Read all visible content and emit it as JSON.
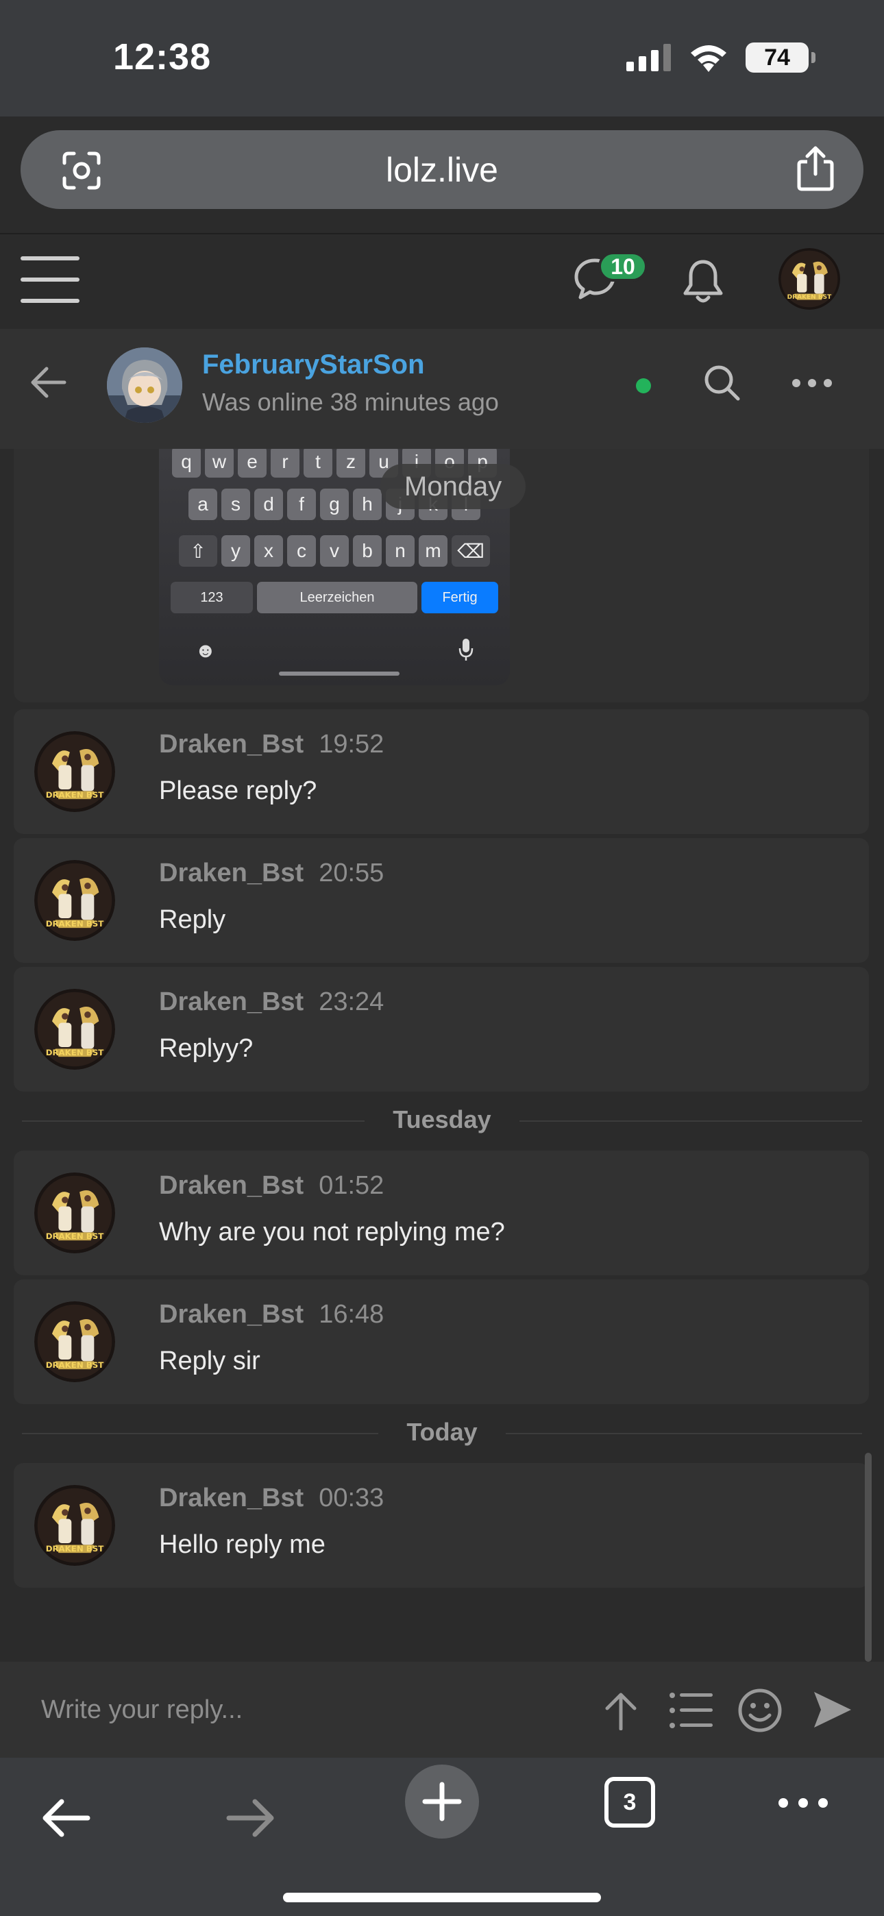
{
  "status_bar": {
    "time": "12:38",
    "battery": "74"
  },
  "browser": {
    "url": "lolz.live",
    "tab_count": "3"
  },
  "site_header": {
    "messages_badge": "10"
  },
  "conversation": {
    "name": "FebruaryStarSon",
    "status": "Was online 38 minutes ago"
  },
  "keyboard_image": {
    "row1": [
      "q",
      "w",
      "e",
      "r",
      "t",
      "z",
      "u",
      "i",
      "o",
      "p"
    ],
    "row2": [
      "a",
      "s",
      "d",
      "f",
      "g",
      "h",
      "j",
      "k",
      "l"
    ],
    "row3": [
      "y",
      "x",
      "c",
      "v",
      "b",
      "n",
      "m"
    ],
    "key_123": "123",
    "key_space": "Leerzeichen",
    "key_done": "Fertig"
  },
  "date_labels": {
    "monday": "Monday",
    "tuesday": "Tuesday",
    "today": "Today"
  },
  "messages": [
    {
      "author": "Draken_Bst",
      "time": "19:52",
      "text": "Please reply?"
    },
    {
      "author": "Draken_Bst",
      "time": "20:55",
      "text": "Reply"
    },
    {
      "author": "Draken_Bst",
      "time": "23:24",
      "text": "Replyy?"
    },
    {
      "author": "Draken_Bst",
      "time": "01:52",
      "text": "Why are you not replying me?"
    },
    {
      "author": "Draken_Bst",
      "time": "16:48",
      "text": "Reply sir"
    },
    {
      "author": "Draken_Bst",
      "time": "00:33",
      "text": "Hello reply me"
    }
  ],
  "reply": {
    "placeholder": "Write your reply..."
  },
  "colors": {
    "accent_name": "#4aa3e0",
    "online": "#23b35b",
    "badge": "#2a9d57",
    "keyboard_done": "#0a7cff"
  }
}
